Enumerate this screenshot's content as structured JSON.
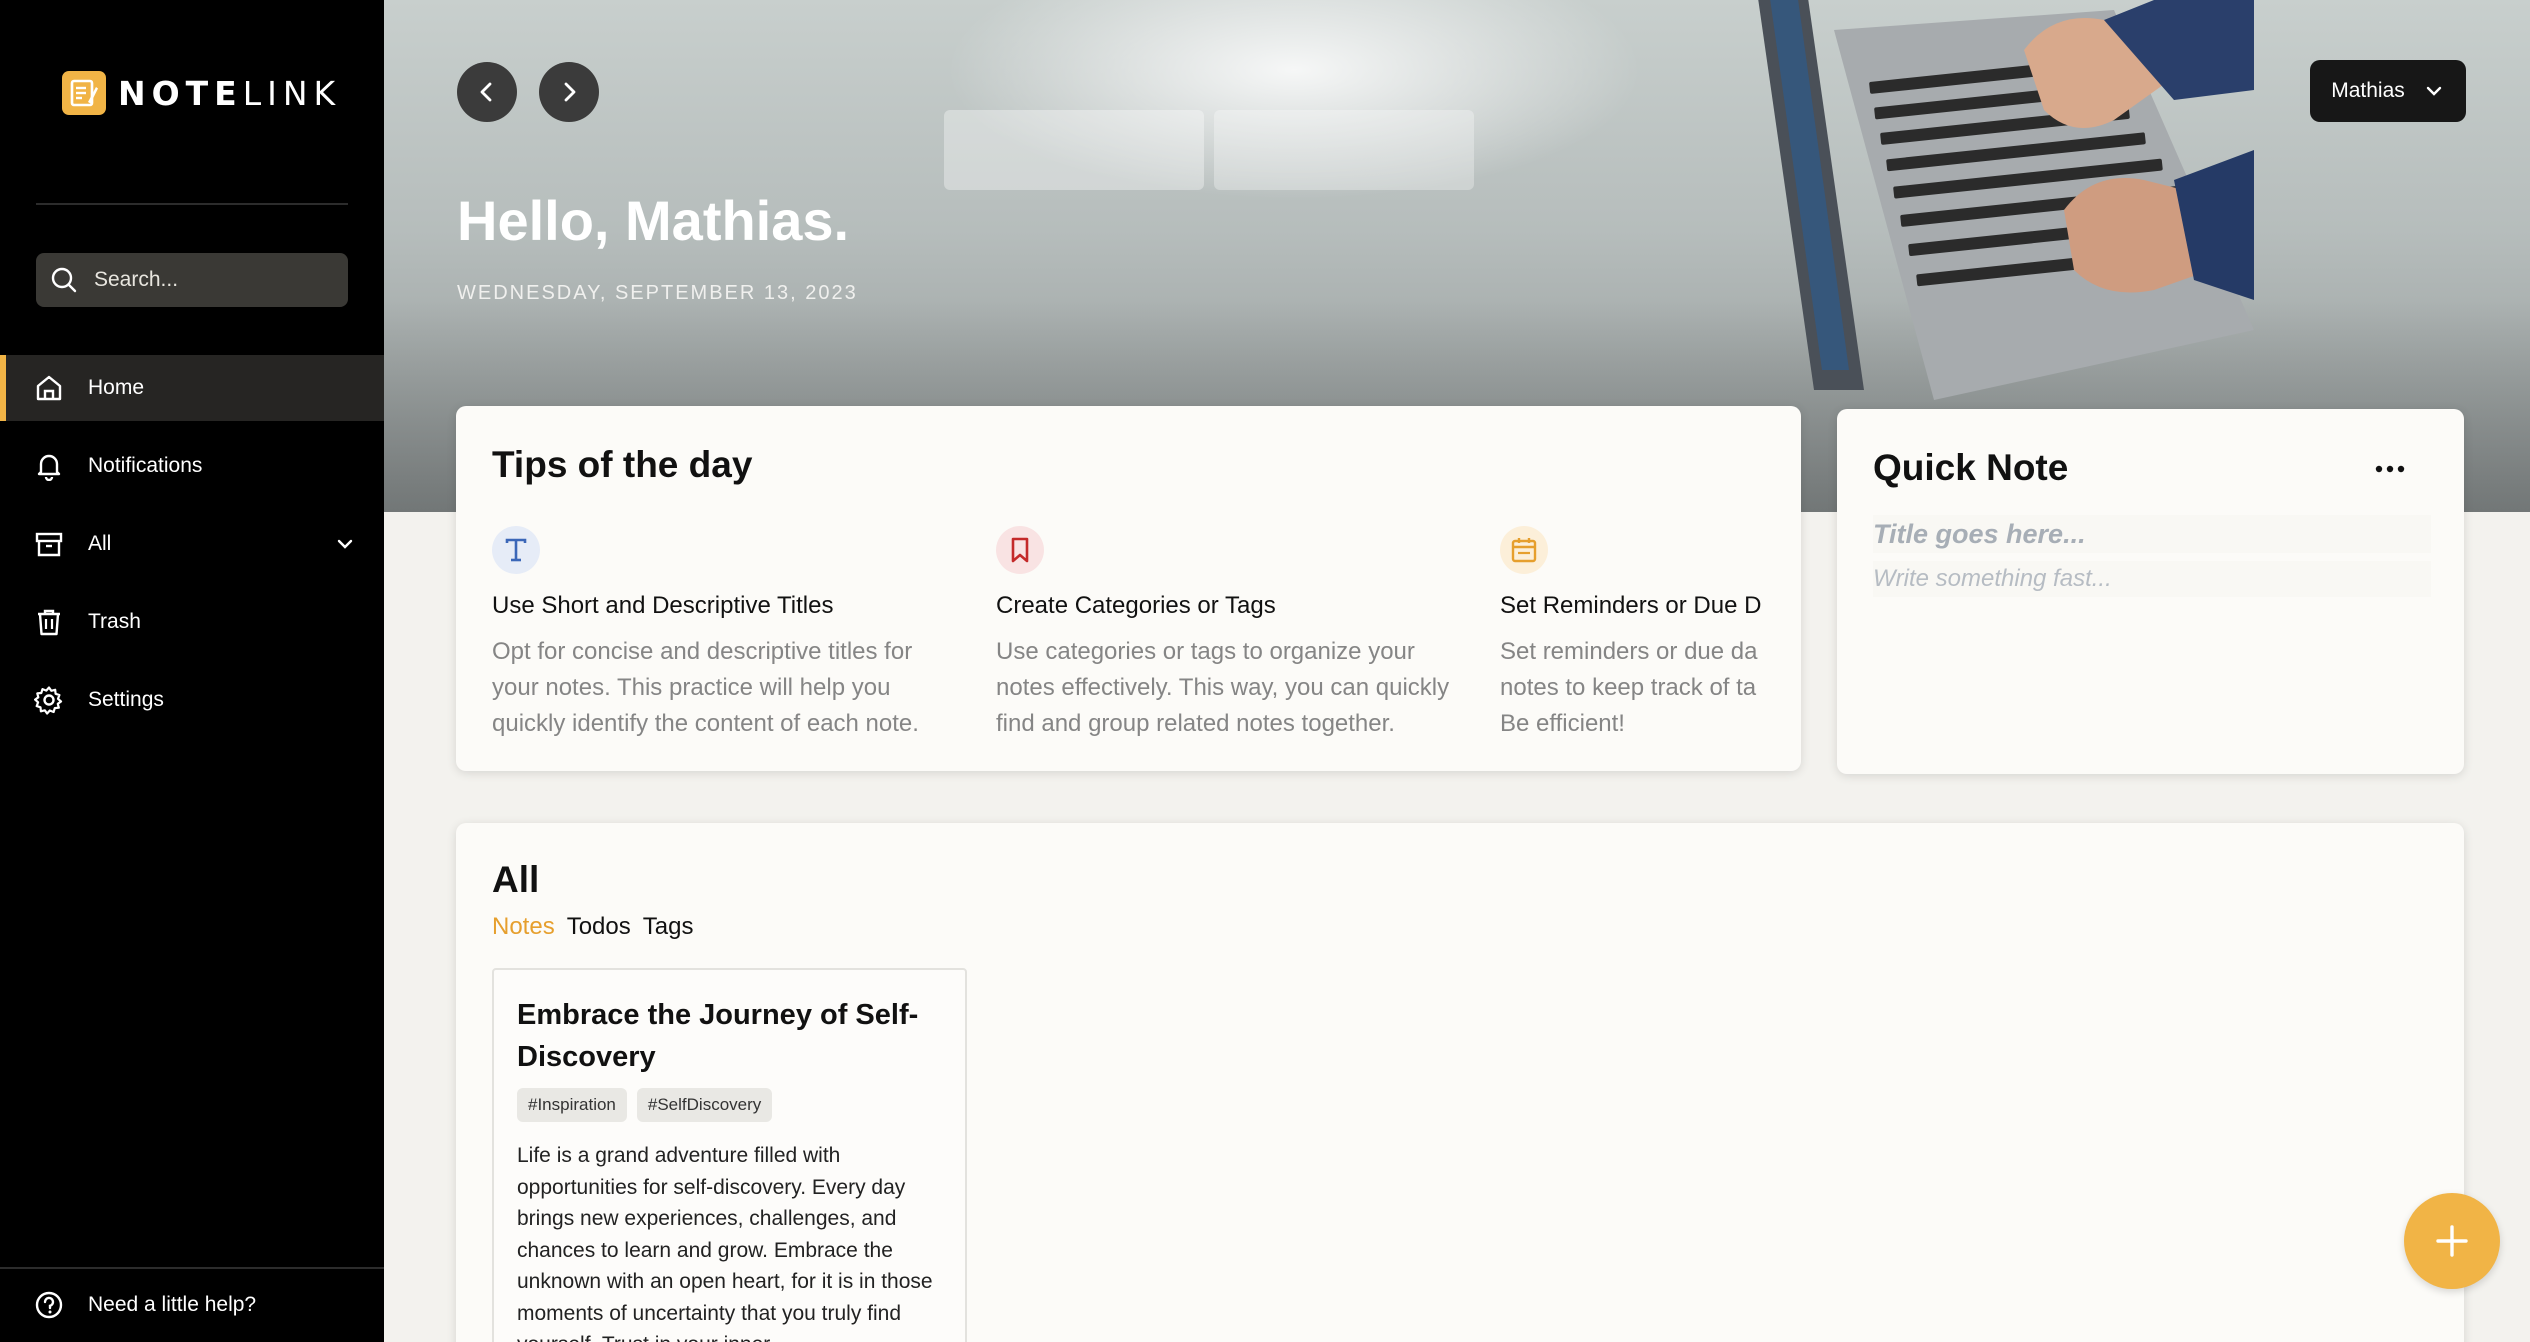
{
  "app": {
    "logo_part1": "NOTE",
    "logo_part2": "LINK",
    "accent_color": "#f1b446"
  },
  "sidebar": {
    "search_placeholder": "Search...",
    "items": [
      {
        "label": "Home",
        "icon": "home-icon",
        "active": true
      },
      {
        "label": "Notifications",
        "icon": "bell-icon"
      },
      {
        "label": "All",
        "icon": "archive-icon",
        "expandable": true
      },
      {
        "label": "Trash",
        "icon": "trash-icon"
      },
      {
        "label": "Settings",
        "icon": "gear-icon"
      }
    ],
    "help_label": "Need a little help?"
  },
  "header": {
    "greeting": "Hello, Mathias.",
    "date": "WEDNESDAY, SEPTEMBER 13, 2023",
    "user_name": "Mathias"
  },
  "tips": {
    "title": "Tips of the day",
    "items": [
      {
        "icon": "text-t-icon",
        "title": "Use Short and Descriptive Titles",
        "body": "Opt for concise and descriptive titles for your notes. This practice will help you quickly identify the content of each note.",
        "icon_color": "#3b67b8",
        "icon_bg": "#e6ecf7"
      },
      {
        "icon": "bookmark-icon",
        "title": "Create Categories or Tags",
        "body": "Use categories or tags to organize your notes effectively. This way, you can quickly find and group related notes together.",
        "icon_color": "#c42a2a",
        "icon_bg": "#f9e3e3"
      },
      {
        "icon": "calendar-icon",
        "title": "Set Reminders or Due D",
        "body_line1": "Set reminders or due da",
        "body_line2": "notes to keep track of ta",
        "body_line3": "Be efficient!",
        "icon_color": "#e69f2d",
        "icon_bg": "#fcefd9"
      }
    ]
  },
  "quick_note": {
    "title": "Quick Note",
    "title_placeholder": "Title goes here...",
    "body_placeholder": "Write something fast..."
  },
  "all_section": {
    "title": "All",
    "tabs": [
      "Notes",
      "Todos",
      "Tags"
    ],
    "active_tab": "Notes",
    "notes": [
      {
        "title": "Embrace the Journey of Self-Discovery",
        "tags": [
          "#Inspiration",
          "#SelfDiscovery"
        ],
        "body": "Life is a grand adventure filled with opportunities for self-discovery. Every day brings new experiences, challenges, and chances to learn and grow. Embrace the unknown with an open heart, for it is in those moments of uncertainty that you truly find yourself. Trust in your inner"
      }
    ]
  }
}
